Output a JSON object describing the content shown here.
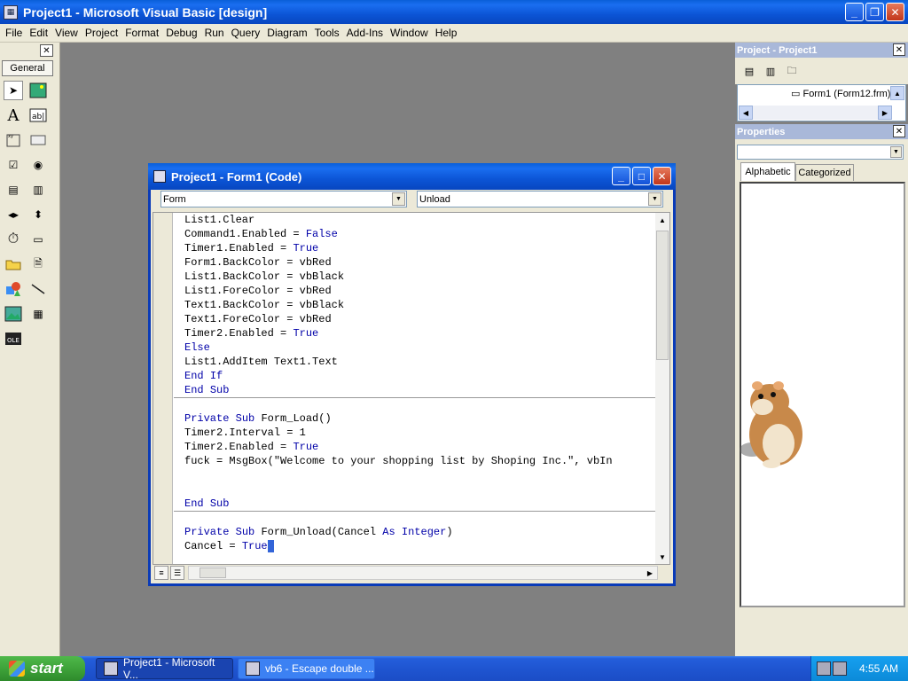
{
  "window": {
    "title": "Project1 - Microsoft Visual Basic [design]"
  },
  "menu": [
    "File",
    "Edit",
    "View",
    "Project",
    "Format",
    "Debug",
    "Run",
    "Query",
    "Diagram",
    "Tools",
    "Add-Ins",
    "Window",
    "Help"
  ],
  "toolbox": {
    "tab_label": "General"
  },
  "project": {
    "title": "Project - Project1",
    "tree_item": "Form1 (Form12.frm)"
  },
  "properties": {
    "title": "Properties",
    "tabs": [
      "Alphabetic",
      "Categorized"
    ]
  },
  "code_window": {
    "title": "Project1 - Form1 (Code)",
    "object_combo": "Form",
    "procedure_combo": "Unload",
    "lines": [
      "List1.Clear",
      "Command1.Enabled = False",
      "Timer1.Enabled = True",
      "Form1.BackColor = vbRed",
      "List1.BackColor = vbBlack",
      "List1.ForeColor = vbRed",
      "Text1.BackColor = vbBlack",
      "Text1.ForeColor = vbRed",
      "Timer2.Enabled = True",
      "Else",
      "List1.AddItem Text1.Text",
      "End If",
      "End Sub",
      "",
      "Private Sub Form_Load()",
      "Timer2.Interval = 1",
      "Timer2.Enabled = True",
      "fuck = MsgBox(\"Welcome to your shopping list by Shoping Inc.\", vbIn",
      "",
      "",
      "End Sub",
      "",
      "Private Sub Form_Unload(Cancel As Integer)",
      "Cancel = True"
    ]
  },
  "taskbar": {
    "start_label": "start",
    "tasks": [
      "Project1 - Microsoft V...",
      "vb6 - Escape double ..."
    ],
    "clock": "4:55 AM"
  }
}
